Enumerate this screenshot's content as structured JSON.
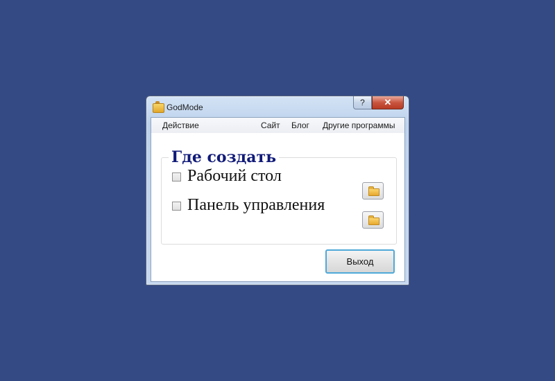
{
  "window": {
    "title": "GodMode",
    "help_glyph": "?",
    "close_glyph": "✕"
  },
  "menu": {
    "action": "Действие",
    "site": "Сайт",
    "blog": "Блог",
    "other_programs": "Другие программы"
  },
  "group": {
    "title": "Где создать",
    "options": [
      {
        "label": "Рабочий стол",
        "checked": false
      },
      {
        "label": "Панель управления",
        "checked": false
      }
    ]
  },
  "buttons": {
    "exit": "Выход"
  },
  "icons": {
    "app": "folder-app-icon",
    "browse": "folder-icon"
  },
  "colors": {
    "desktop": "#344a85",
    "group_title": "#101a78",
    "default_button_border": "#4ea8d8"
  }
}
